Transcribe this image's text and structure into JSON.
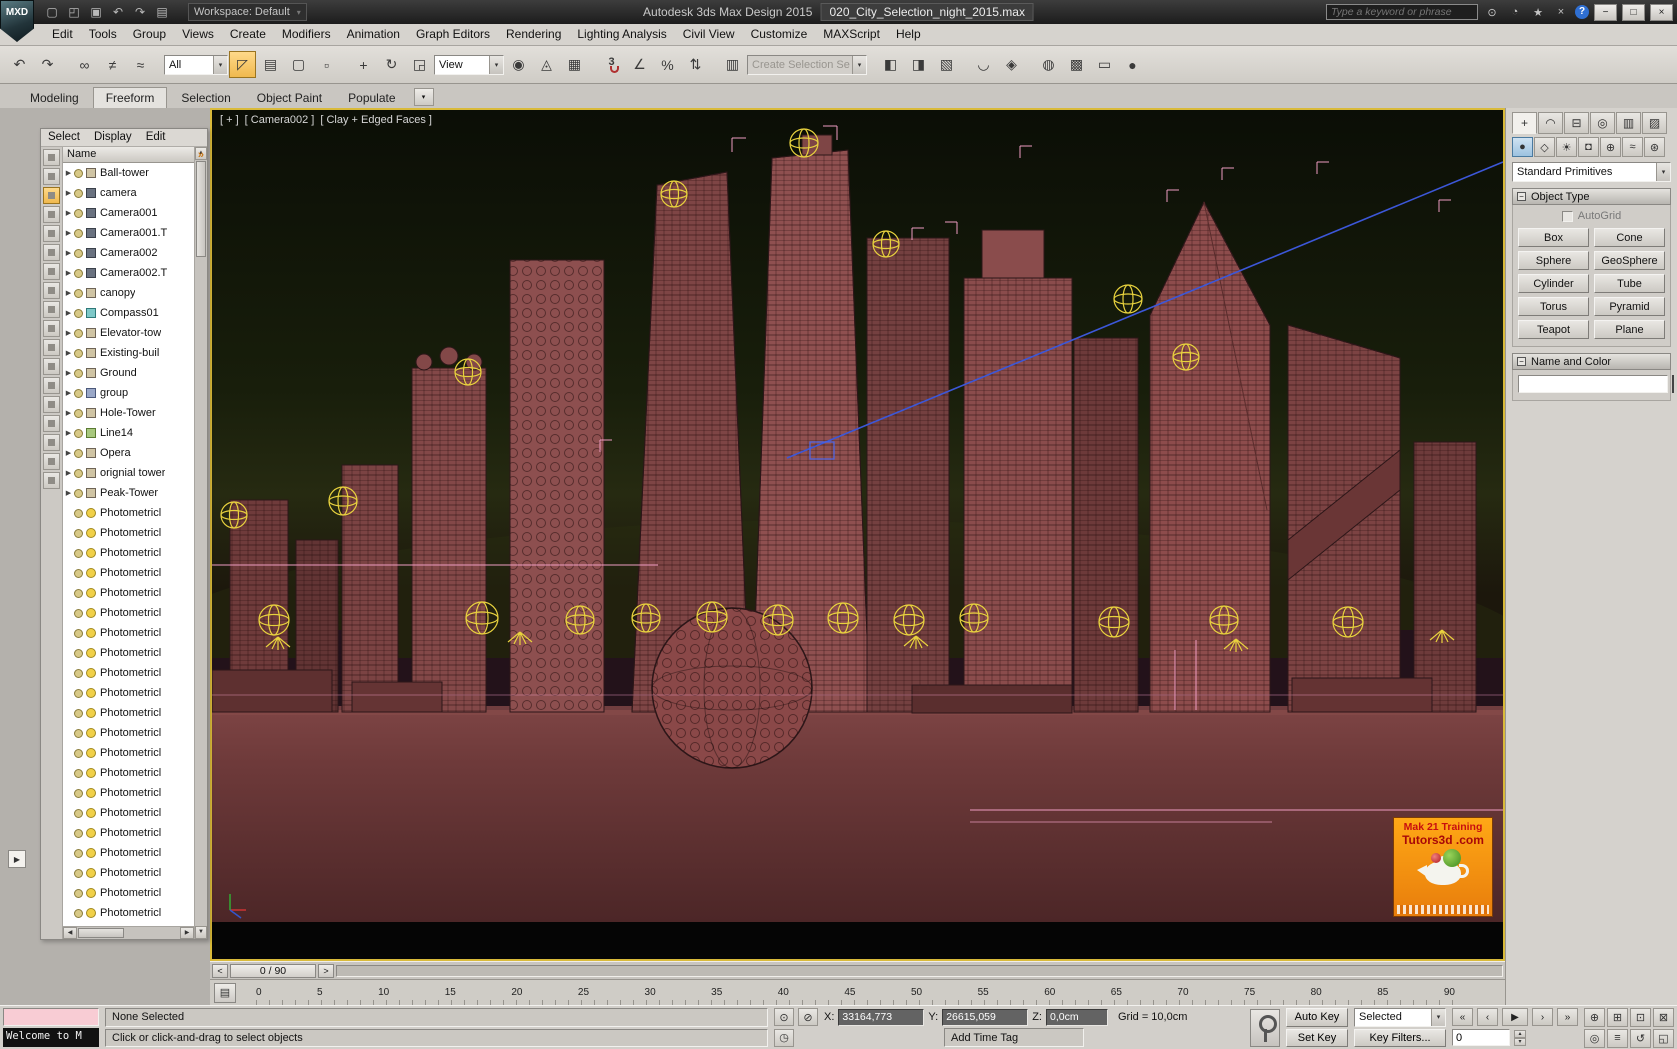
{
  "titlebar": {
    "logo_text": "MXD",
    "workspace_label": "Workspace: Default",
    "app_title": "Autodesk 3ds Max Design 2015",
    "document_title": "020_City_Selection_night_2015.max",
    "search_placeholder": "Type a keyword or phrase"
  },
  "menubar": {
    "items": [
      "Edit",
      "Tools",
      "Group",
      "Views",
      "Create",
      "Modifiers",
      "Animation",
      "Graph Editors",
      "Rendering",
      "Lighting Analysis",
      "Civil View",
      "Customize",
      "MAXScript",
      "Help"
    ]
  },
  "toolbar": {
    "selection_filter_value": "All",
    "coordsys_value": "View",
    "named_selection_placeholder": "Create Selection Se",
    "snap_count": "3"
  },
  "ribbon": {
    "tabs": [
      {
        "label": "Modeling",
        "state": ""
      },
      {
        "label": "Freeform",
        "state": "active"
      },
      {
        "label": "Selection",
        "state": ""
      },
      {
        "label": "Object Paint",
        "state": ""
      },
      {
        "label": "Populate",
        "state": ""
      }
    ]
  },
  "scene_explorer": {
    "menus": [
      "Select",
      "Display",
      "Edit"
    ],
    "overflow_chevron": "»",
    "column_header": "Name",
    "items": [
      {
        "arrow": "▶",
        "type": "geometry",
        "label": "Ball-tower"
      },
      {
        "arrow": "▶",
        "type": "camera",
        "label": "camera"
      },
      {
        "arrow": "▶",
        "type": "camera",
        "label": "Camera001"
      },
      {
        "arrow": "▶",
        "type": "camera",
        "label": "Camera001.T"
      },
      {
        "arrow": "▶",
        "type": "camera",
        "label": "Camera002"
      },
      {
        "arrow": "▶",
        "type": "camera",
        "label": "Camera002.T"
      },
      {
        "arrow": "▶",
        "type": "geometry",
        "label": "canopy"
      },
      {
        "arrow": "▶",
        "type": "helper",
        "label": "Compass01"
      },
      {
        "arrow": "▶",
        "type": "geometry",
        "label": "Elevator-tow"
      },
      {
        "arrow": "▶",
        "type": "geometry",
        "label": "Existing-buil"
      },
      {
        "arrow": "▶",
        "type": "geometry",
        "label": "Ground"
      },
      {
        "arrow": "▶",
        "type": "group",
        "label": "group"
      },
      {
        "arrow": "▶",
        "type": "geometry",
        "label": "Hole-Tower"
      },
      {
        "arrow": "▶",
        "type": "shape",
        "label": "Line14"
      },
      {
        "arrow": "▶",
        "type": "geometry",
        "label": "Opera"
      },
      {
        "arrow": "▶",
        "type": "geometry",
        "label": "orignial tower"
      },
      {
        "arrow": "▶",
        "type": "geometry",
        "label": "Peak-Tower"
      },
      {
        "arrow": "",
        "type": "light",
        "label": "Photometricl"
      },
      {
        "arrow": "",
        "type": "light",
        "label": "Photometricl"
      },
      {
        "arrow": "",
        "type": "light",
        "label": "Photometricl"
      },
      {
        "arrow": "",
        "type": "light",
        "label": "Photometricl"
      },
      {
        "arrow": "",
        "type": "light",
        "label": "Photometricl"
      },
      {
        "arrow": "",
        "type": "light",
        "label": "Photometricl"
      },
      {
        "arrow": "",
        "type": "light",
        "label": "Photometricl"
      },
      {
        "arrow": "",
        "type": "light",
        "label": "Photometricl"
      },
      {
        "arrow": "",
        "type": "light",
        "label": "Photometricl"
      },
      {
        "arrow": "",
        "type": "light",
        "label": "Photometricl"
      },
      {
        "arrow": "",
        "type": "light",
        "label": "Photometricl"
      },
      {
        "arrow": "",
        "type": "light",
        "label": "Photometricl"
      },
      {
        "arrow": "",
        "type": "light",
        "label": "Photometricl"
      },
      {
        "arrow": "",
        "type": "light",
        "label": "Photometricl"
      },
      {
        "arrow": "",
        "type": "light",
        "label": "Photometricl"
      },
      {
        "arrow": "",
        "type": "light",
        "label": "Photometricl"
      },
      {
        "arrow": "",
        "type": "light",
        "label": "Photometricl"
      },
      {
        "arrow": "",
        "type": "light",
        "label": "Photometricl"
      },
      {
        "arrow": "",
        "type": "light",
        "label": "Photometricl"
      },
      {
        "arrow": "",
        "type": "light",
        "label": "Photometricl"
      },
      {
        "arrow": "",
        "type": "light",
        "label": "Photometricl"
      }
    ]
  },
  "viewport": {
    "label_general": "[ + ]",
    "label_pov": "[ Camera002 ]",
    "label_shading": "[ Clay + Edged Faces ]",
    "watermark": {
      "line1": "Mak 21 Training",
      "line2": "Tutors3d .com"
    }
  },
  "timeline": {
    "frame_display": "0 / 90",
    "prev_arrow": "<",
    "next_arrow": ">",
    "ruler_ticks": [
      "0",
      "5",
      "10",
      "15",
      "20",
      "25",
      "30",
      "35",
      "40",
      "45",
      "50",
      "55",
      "60",
      "65",
      "70",
      "75",
      "80",
      "85",
      "90"
    ]
  },
  "command_panel": {
    "primitives_dropdown_value": "Standard Primitives",
    "object_type_rollout": "Object Type",
    "autogrid_label": "AutoGrid",
    "object_buttons": [
      "Box",
      "Cone",
      "Sphere",
      "GeoSphere",
      "Cylinder",
      "Tube",
      "Torus",
      "Pyramid",
      "Teapot",
      "Plane"
    ],
    "name_color_rollout": "Name and Color",
    "object_color": "#e85592"
  },
  "statusbar": {
    "listener_text": "Welcome to M",
    "selection_status": "None Selected",
    "prompt_text": "Click or click-and-drag to select objects",
    "coord_x_label": "X:",
    "coord_x": "33164,773",
    "coord_y_label": "Y:",
    "coord_y": "26615,059",
    "coord_z_label": "Z:",
    "coord_z": "0,0cm",
    "grid_label": "Grid = 10,0cm",
    "add_time_tag": "Add Time Tag",
    "auto_key_label": "Auto Key",
    "set_key_label": "Set Key",
    "key_mode_value": "Selected",
    "key_filters_label": "Key Filters...",
    "frame_value": "0"
  },
  "colors": {
    "viewport_active_border": "#d9ba3a",
    "object_color_swatch": "#e85592"
  },
  "icons": {
    "new": "▢",
    "open": "◰",
    "save": "▣",
    "undo": "↶",
    "redo": "↷",
    "project": "▤",
    "search-mag": "⊙",
    "community": "◔",
    "star": "★",
    "close-x": "×",
    "help": "?",
    "win-min": "−",
    "win-max": "□",
    "win-close": "×",
    "dd-arrow": "▾",
    "link": "∞",
    "unlink": "≠",
    "bind": "≈",
    "sel-obj": "◸",
    "sel-name": "▤",
    "rect-region": "▢",
    "win-cross": "▫",
    "move": "+",
    "rotate": "↻",
    "scale": "◲",
    "use-center": "◉",
    "manipulate": "◬",
    "kbd": "▦",
    "angle": "∠",
    "percent": "%",
    "spinner": "⇅",
    "named-sets": "▥",
    "mirror": "◧",
    "align": "◨",
    "layers": "▧",
    "curve-ed": "◡",
    "schematic": "◈",
    "material": "◍",
    "render-setup": "▩",
    "render-frame": "▭",
    "render": "●",
    "create-tab": "+",
    "modify-tab": "◠",
    "hierarchy-tab": "⊟",
    "motion-tab": "◎",
    "display-tab": "▥",
    "util-tab": "▨",
    "cat-geometry": "●",
    "cat-shapes": "◇",
    "cat-lights": "☀",
    "cat-cameras": "◘",
    "cat-helpers": "⊕",
    "cat-sw": "≈",
    "cat-systems": "⊛",
    "t-start": "«",
    "t-prev": "‹",
    "t-play": "▶",
    "t-next": "›",
    "t-end": "»",
    "nav-zoom": "⊕",
    "nav-zoomall": "⊞",
    "nav-ext": "⊡",
    "nav-extall": "⊠",
    "nav-fov": "◎",
    "nav-pan": "≡",
    "nav-arc": "↺",
    "nav-max": "◱",
    "isolate": "⊙",
    "lock-sel": "⊘",
    "clock": "◷",
    "spin-up": "▴",
    "spin-down": "▾",
    "ruler-tool": "▤",
    "gutter-open": "▶",
    "trackbar-toggle": "◡"
  }
}
